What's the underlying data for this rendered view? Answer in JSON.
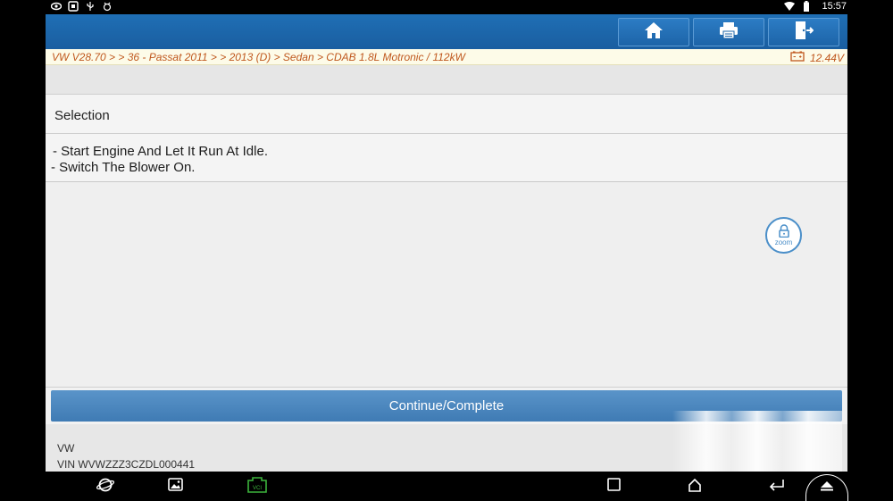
{
  "status_bar": {
    "time": "15:57",
    "left_icons": [
      "eye-icon",
      "screen-record-icon",
      "usb-icon",
      "debug-icon"
    ],
    "right_icons": [
      "wifi-icon",
      "battery-icon"
    ]
  },
  "toolbar": {
    "buttons": [
      {
        "name": "home",
        "icon": "home-icon"
      },
      {
        "name": "print",
        "icon": "printer-icon"
      },
      {
        "name": "exit",
        "icon": "exit-icon"
      }
    ]
  },
  "breadcrumb": {
    "path": "VW V28.70 >  > 36 - Passat 2011 > > 2013 (D) > Sedan > CDAB 1.8L Motronic / 112kW",
    "voltage": "12.44V"
  },
  "section": {
    "title": "Selection"
  },
  "instructions": {
    "line1": " - Start Engine And Let It Run At Idle.",
    "line2": "- Switch The Blower On."
  },
  "zoom": {
    "label": "zoom"
  },
  "actions": {
    "continue_label": "Continue/Complete"
  },
  "vehicle": {
    "make": "VW",
    "vin_text": "VIN WVWZZZ3CZDL000441"
  },
  "nav_bar": {
    "buttons": [
      "browser-icon",
      "gallery-icon",
      "vci-icon",
      "recents-icon",
      "home-nav-icon",
      "back-icon",
      "up-arrow-icon"
    ],
    "vci_label": "VCI"
  },
  "colors": {
    "header_blue": "#1a5ea0",
    "breadcrumb_text": "#c0581e",
    "continue_button": "#4a86bd",
    "vci_green": "#3cb43c"
  }
}
